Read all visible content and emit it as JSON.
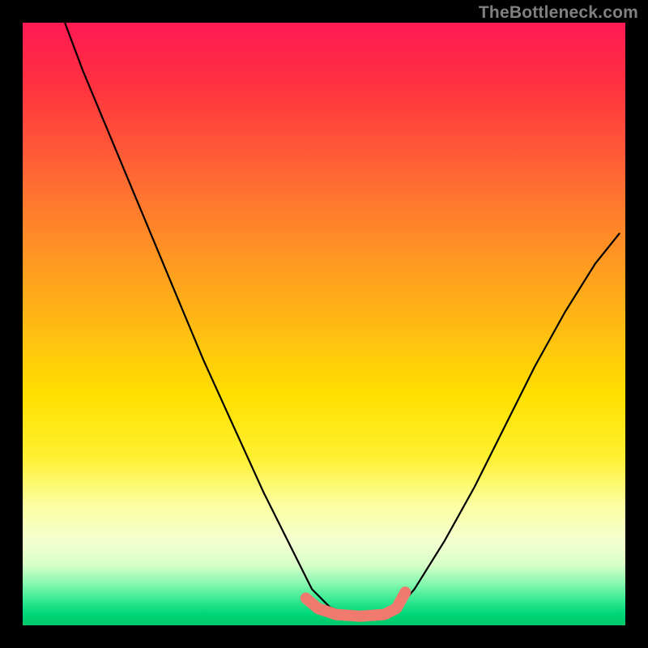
{
  "attribution": "TheBottleneck.com",
  "colors": {
    "frame_bg": "#000000",
    "gradient_top": "#ff1a53",
    "gradient_bottom": "#00c86a",
    "curve": "#000000",
    "band": "#ef7a6d"
  },
  "chart_data": {
    "type": "line",
    "title": "",
    "xlabel": "",
    "ylabel": "",
    "xlim": [
      0,
      1
    ],
    "ylim": [
      0,
      1
    ],
    "series": [
      {
        "name": "main-curve",
        "x": [
          0.07,
          0.1,
          0.15,
          0.2,
          0.25,
          0.3,
          0.35,
          0.4,
          0.45,
          0.48,
          0.51,
          0.55,
          0.6,
          0.62,
          0.65,
          0.7,
          0.75,
          0.8,
          0.85,
          0.9,
          0.95,
          0.99
        ],
        "y": [
          1.0,
          0.92,
          0.8,
          0.68,
          0.56,
          0.44,
          0.33,
          0.22,
          0.12,
          0.06,
          0.03,
          0.015,
          0.015,
          0.025,
          0.06,
          0.14,
          0.23,
          0.33,
          0.43,
          0.52,
          0.6,
          0.65
        ]
      },
      {
        "name": "valley-band",
        "x": [
          0.47,
          0.49,
          0.52,
          0.56,
          0.6,
          0.62,
          0.635
        ],
        "y": [
          0.045,
          0.028,
          0.018,
          0.015,
          0.018,
          0.028,
          0.055
        ]
      }
    ],
    "annotations": []
  }
}
